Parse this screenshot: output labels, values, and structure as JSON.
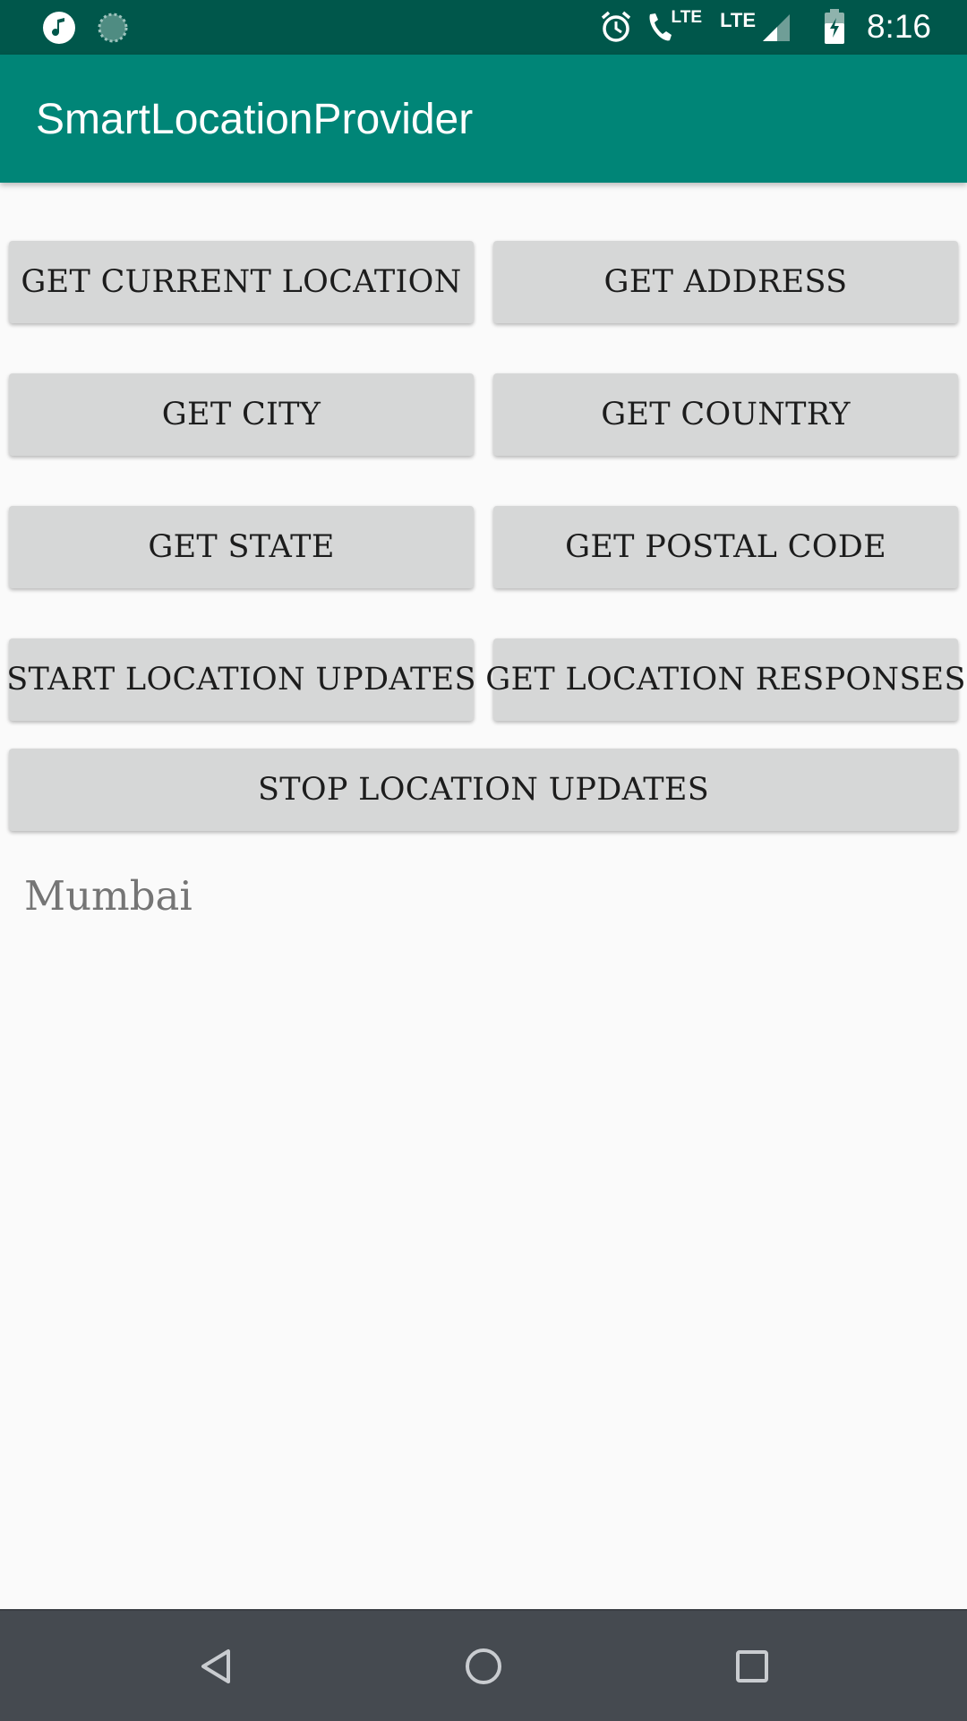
{
  "status_bar": {
    "time": "8:16",
    "network_1": "LTE",
    "network_2": "LTE",
    "icons": [
      "music-icon",
      "loader-icon",
      "alarm-icon",
      "wifi-calling-icon",
      "signal-icon",
      "battery-charging-icon"
    ]
  },
  "app_bar": {
    "title": "SmartLocationProvider"
  },
  "buttons": {
    "get_current_location": "GET CURRENT LOCATION",
    "get_address": "GET ADDRESS",
    "get_city": "GET CITY",
    "get_country": "GET COUNTRY",
    "get_state": "GET STATE",
    "get_postal_code": "GET POSTAL CODE",
    "start_location_updates": "START LOCATION UPDATES",
    "get_location_responses": "GET LOCATION RESPONSES",
    "stop_location_updates": "STOP LOCATION UPDATES"
  },
  "result": {
    "text": "Mumbai"
  },
  "nav_bar": {
    "icons": [
      "back-icon",
      "home-icon",
      "recents-icon"
    ]
  },
  "colors": {
    "status_bar": "#00574b",
    "app_bar": "#008577",
    "button": "#d6d7d7",
    "background": "#fafafa",
    "nav_bar": "#454a50"
  }
}
